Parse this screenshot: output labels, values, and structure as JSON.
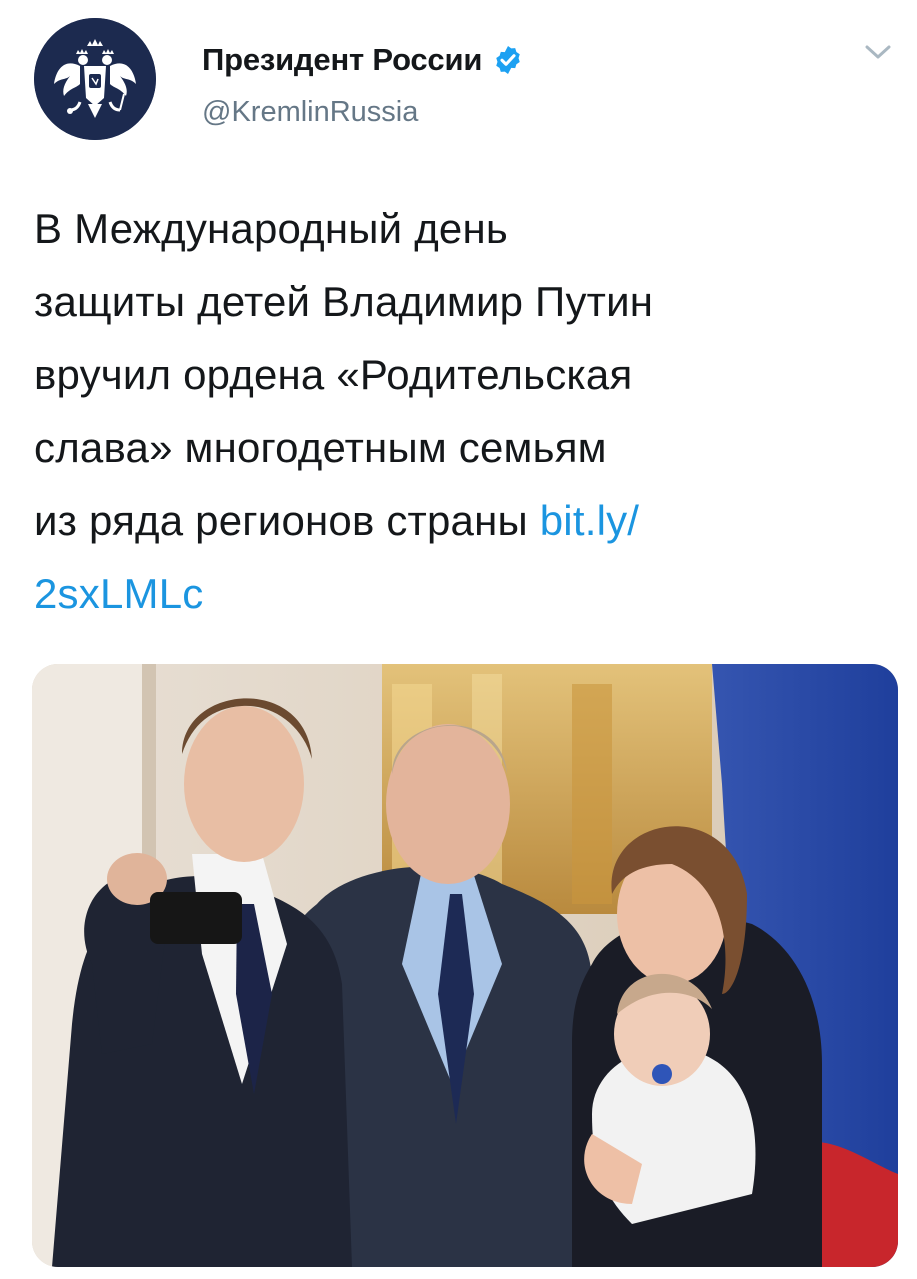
{
  "tweet": {
    "display_name": "Президент России",
    "username": "@KremlinRussia",
    "text_lines": [
      "В Международный день",
      "защиты детей Владимир Путин",
      "вручил ордена «Родительская",
      "слава» многодетным семьям",
      "из ряда регионов страны "
    ],
    "link_part_1": "bit.ly/",
    "link_part_2": "2sxLMLc",
    "verified_badge": "verified-badge",
    "avatar_icon": "double-headed-eagle-emblem",
    "menu_icon": "chevron-down-icon"
  },
  "colors": {
    "link": "#1b95e0",
    "verified": "#1da1f2",
    "avatar_bg": "#1c2a4f",
    "secondary_text": "#657786",
    "primary_text": "#14171a"
  }
}
